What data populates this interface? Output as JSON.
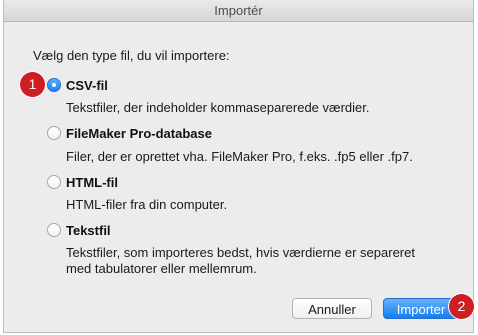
{
  "dialog": {
    "title": "Importér",
    "prompt": "Vælg den type fil, du vil importere:"
  },
  "options": [
    {
      "label": "CSV-fil",
      "selected": true,
      "description": [
        "Tekstfiler, der indeholder kommaseparerede værdier."
      ]
    },
    {
      "label": "FileMaker Pro-database",
      "selected": false,
      "description": [
        "Filer, der er oprettet vha. FileMaker Pro, f.eks. .fp5 eller .fp7."
      ]
    },
    {
      "label": "HTML-fil",
      "selected": false,
      "description": [
        "HTML-filer fra din computer."
      ]
    },
    {
      "label": "Tekstfil",
      "selected": false,
      "description": [
        "Tekstfiler, som importeres bedst, hvis værdierne er separeret",
        "med tabulatorer eller mellemrum."
      ]
    }
  ],
  "buttons": {
    "cancel_label": "Annuller",
    "import_label": "Importer"
  },
  "callouts": [
    "1",
    "2"
  ],
  "colors": {
    "accent": "#1a82f6",
    "callout": "#cf1d24"
  }
}
